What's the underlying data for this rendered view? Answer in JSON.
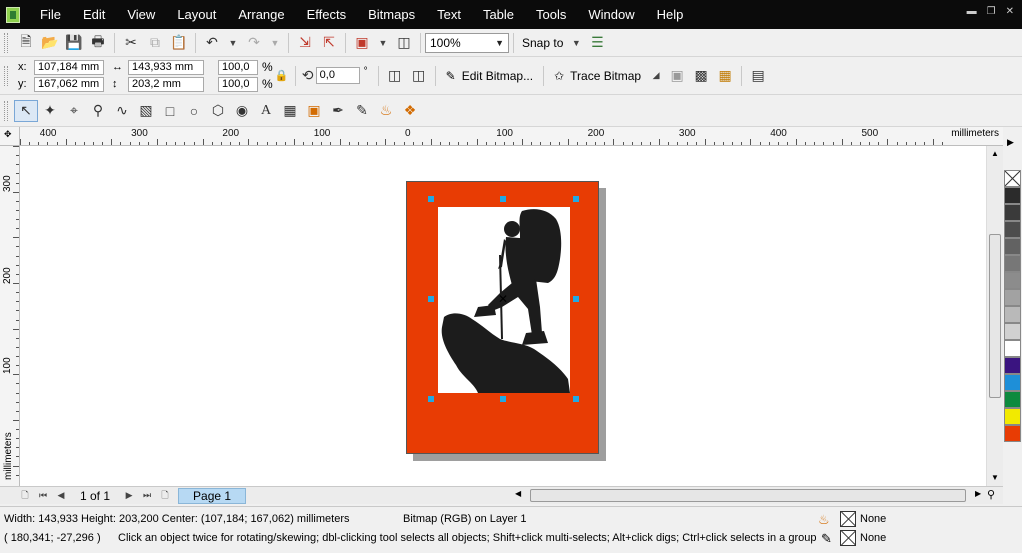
{
  "menu": {
    "items": [
      "File",
      "Edit",
      "View",
      "Layout",
      "Arrange",
      "Effects",
      "Bitmaps",
      "Text",
      "Table",
      "Tools",
      "Window",
      "Help"
    ]
  },
  "standard_toolbar": {
    "zoom_value": "100%",
    "snap_to_label": "Snap to"
  },
  "property_bar": {
    "x_label": "x:",
    "x_value": "107,184 mm",
    "y_label": "y:",
    "y_value": "167,062 mm",
    "width_value": "143,933 mm",
    "height_value": "203,2 mm",
    "scale_x": "100,0",
    "scale_y": "100,0",
    "percent": "%",
    "rotation": "0,0",
    "degree": "°",
    "edit_bitmap_label": "Edit Bitmap...",
    "trace_bitmap_label": "Trace Bitmap"
  },
  "ruler": {
    "h_labels": [
      "400",
      "300",
      "200",
      "100",
      "0",
      "100",
      "200",
      "300",
      "400",
      "500"
    ],
    "v_labels": [
      "300",
      "200",
      "100"
    ],
    "units": "millimeters"
  },
  "navigator": {
    "page_count": "1 of 1",
    "page_tab": "Page 1"
  },
  "status": {
    "dimensions": "Width: 143,933 Height: 203,200 Center: (107,184; 167,062) millimeters",
    "object_info": "Bitmap (RGB) on Layer 1",
    "cursor_coords": "( 180,341; -27,296 )",
    "hint": "Click an object twice for rotating/skewing; dbl-clicking tool selects all objects; Shift+click multi-selects; Alt+click digs; Ctrl+click selects in a group",
    "fill_value": "None",
    "outline_value": "None"
  },
  "palette": {
    "colors": [
      "#2b2b2b",
      "#3a3a3a",
      "#4d4d4d",
      "#626262",
      "#777777",
      "#8c8c8c",
      "#a2a2a2",
      "#b9b9b9",
      "#d1d1d1",
      "#ffffff",
      "#3a1480",
      "#1e8fd8",
      "#0d8a3e",
      "#f2ea00",
      "#e83c04"
    ]
  },
  "colors": {
    "page_fill": "#e83c04",
    "selection_handle": "#22a8e4",
    "menubar": "#0b0b0b",
    "page_tab": "#b7d9f3"
  }
}
